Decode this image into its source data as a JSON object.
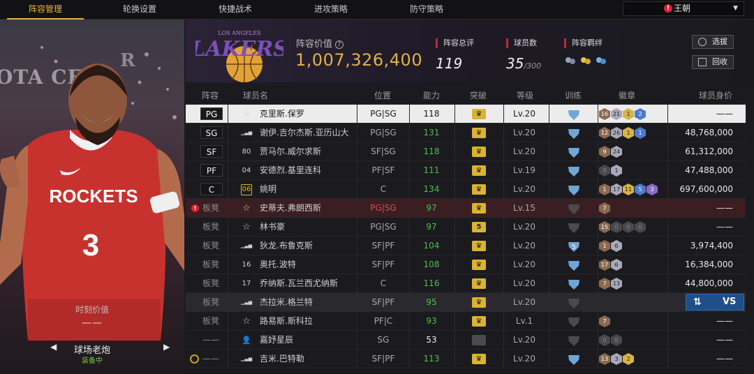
{
  "nav": {
    "tabs": [
      "阵容管理",
      "轮换设置",
      "快捷战术",
      "进攻策略",
      "防守策略"
    ],
    "active_tab": 0,
    "team_selector": "王朝"
  },
  "player_card": {
    "arena_text": "OTA CE",
    "arena_text2": "R",
    "jersey_team": "ROCKETS",
    "jersey_number": "3",
    "moment_value_label": "时刻价值",
    "moment_value": "——",
    "card_name": "球场老炮",
    "equipped": "装备中"
  },
  "team": {
    "logo_top": "LOS ANGELES",
    "logo_name": "LAKERS",
    "value_label": "阵容价值",
    "value": "1,007,326,400",
    "rating_label": "阵容总评",
    "rating": "119",
    "players_label": "球员数",
    "players_count": "35",
    "players_max": "/300",
    "bond_label": "阵容羁绊",
    "btn_select": "选拔",
    "btn_recycle": "回收"
  },
  "columns": {
    "lineup": "阵容",
    "name": "球员名",
    "position": "位置",
    "ability": "能力",
    "breakthrough": "突破",
    "level": "等级",
    "training": "训练",
    "badge": "徽章",
    "salary": "球员身价"
  },
  "rows": [
    {
      "slot": "PG",
      "tier": "star-dark",
      "name": "克里斯.保罗",
      "pos": "PG|SG",
      "ability": "118",
      "level": "Lv.20",
      "salary": "——",
      "badges": [
        "16",
        "21",
        "1",
        "2"
      ]
    },
    {
      "slot": "SG",
      "tier": "bars",
      "name": "谢伊.吉尔杰斯.亚历山大",
      "pos": "PG|SG",
      "ability": "131",
      "level": "Lv.20",
      "salary": "48,768,000",
      "badges": [
        "12",
        "26",
        "1",
        "1"
      ]
    },
    {
      "slot": "SF",
      "tier": "80",
      "name": "贾马尔.威尔求斯",
      "pos": "SF|SG",
      "ability": "118",
      "level": "Lv.20",
      "salary": "61,312,000",
      "badges": [
        "9",
        "24"
      ]
    },
    {
      "slot": "PF",
      "tier": "04",
      "name": "安德烈.基里连科",
      "pos": "PF|SF",
      "ability": "111",
      "level": "Lv.19",
      "salary": "47,488,000",
      "badges": [
        "0",
        "1"
      ]
    },
    {
      "slot": "C",
      "tier": "06",
      "name": "姚明",
      "pos": "C",
      "ability": "134",
      "level": "Lv.20",
      "salary": "697,600,000",
      "badges": [
        "1",
        "17",
        "11",
        "5",
        "3"
      ]
    },
    {
      "slot": "板凳",
      "tier": "star",
      "name": "史蒂夫.弗朗西斯",
      "pos": "PG|SG",
      "ability": "97",
      "level": "Lv.15",
      "salary": "——",
      "badges": [
        "7"
      ]
    },
    {
      "slot": "板凳",
      "tier": "star",
      "name": "林书豪",
      "pos": "PG|SG",
      "ability": "97",
      "break": "5",
      "level": "Lv.20",
      "salary": "——",
      "badges": [
        "15",
        "0",
        "0",
        "0"
      ]
    },
    {
      "slot": "板凳",
      "tier": "bars",
      "name": "狄龙.布鲁克斯",
      "pos": "SF|PF",
      "ability": "104",
      "train": "5",
      "level": "Lv.20",
      "salary": "3,974,400",
      "badges": [
        "1",
        "6"
      ]
    },
    {
      "slot": "板凳",
      "tier": "16",
      "name": "奥托.波特",
      "pos": "SF|PF",
      "ability": "108",
      "level": "Lv.20",
      "salary": "16,384,000",
      "badges": [
        "17",
        "6"
      ]
    },
    {
      "slot": "板凳",
      "tier": "17",
      "name": "乔纳斯.瓦兰西尤纳斯",
      "pos": "C",
      "ability": "116",
      "level": "Lv.20",
      "salary": "44,800,000",
      "badges": [
        "7",
        "13"
      ]
    },
    {
      "slot": "板凳",
      "tier": "bars",
      "name": "杰拉米.格兰特",
      "pos": "SF|PF",
      "ability": "95",
      "level": "Lv.20",
      "salary": "",
      "badges": [],
      "vs": "VS"
    },
    {
      "slot": "板凳",
      "tier": "star",
      "name": "路易斯.斯科拉",
      "pos": "PF|C",
      "ability": "93",
      "level": "Lv.1",
      "salary": "——",
      "badges": [
        "7"
      ]
    },
    {
      "slot": "——",
      "tier": "person",
      "name": "嘉妤星辰",
      "pos": "SG",
      "ability": "53",
      "level": "Lv.20",
      "salary": "——",
      "badges": [
        "0",
        "0"
      ]
    },
    {
      "slot": "——",
      "tier": "bars",
      "name": "吉米.巴特勒",
      "pos": "SF|PF",
      "ability": "113",
      "level": "Lv.20",
      "salary": "——",
      "badges": [
        "13",
        "3",
        "2"
      ]
    }
  ],
  "colors": {
    "accent": "#e6b23a",
    "ability_green": "#4cbf4c",
    "alert_red": "#c0283a",
    "vs_blue": "#1e4f8a"
  }
}
